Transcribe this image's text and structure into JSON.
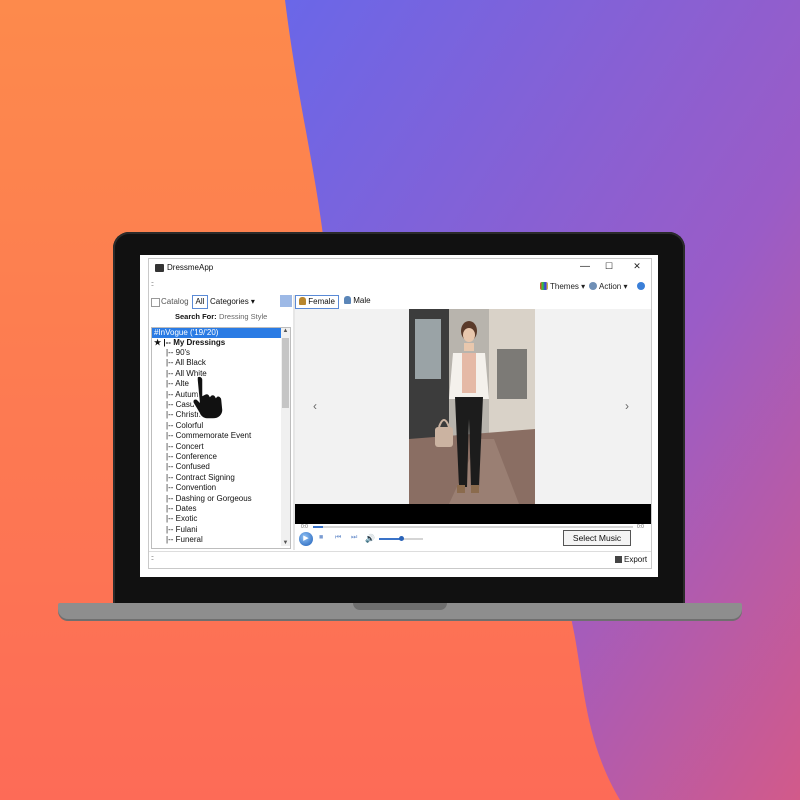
{
  "app": {
    "title": "DressmeApp",
    "window_controls": {
      "minimize": "—",
      "maximize": "☐",
      "close": "✕"
    }
  },
  "toolbar": {
    "grip": "::",
    "themes_label": "Themes",
    "themes_icon": "palette-icon",
    "action_label": "Action",
    "action_icon": "gear-icon",
    "help_icon": "help-icon",
    "dropdown_glyph": "▾"
  },
  "filter": {
    "catalog_label": "Catalog",
    "all_label": "All",
    "categories_label": "Categories",
    "search_for_label": "Search For:",
    "search_for_value": "Dressing Style"
  },
  "tree": {
    "selected_item": "#InVogue ('19/'20)",
    "root_marker": "★",
    "root_label": "|-- My Dressings",
    "items": [
      "|-- 90's",
      "|-- All Black",
      "|-- All White",
      "|-- Alte",
      "|-- Autum",
      "|-- Casua",
      "|-- Christmas",
      "|-- Colorful",
      "|-- Commemorate Event",
      "|-- Concert",
      "|-- Conference",
      "|-- Confused",
      "|-- Contract Signing",
      "|-- Convention",
      "|-- Dashing or Gorgeous",
      "|-- Dates",
      "|-- Exotic",
      "|-- Fulani",
      "|-- Funeral"
    ],
    "scroll_up": "▲",
    "scroll_down": "▼"
  },
  "gender_tabs": {
    "female_label": "Female",
    "male_label": "Male",
    "active": "Female"
  },
  "viewer": {
    "prev_arrow": "‹",
    "next_arrow": "›"
  },
  "player": {
    "elapsed": "0:0",
    "remaining": "0:0",
    "play_icon": "▶",
    "stop_icon": "■",
    "prev_icon": "⏮",
    "next_icon": "⏭",
    "volume_icon": "🔊",
    "select_music_label": "Select Music",
    "seek_position": 0.03,
    "volume_level": 0.5
  },
  "status": {
    "export_label": "Export"
  },
  "colors": {
    "selection_blue": "#2a7be4",
    "accent_blue": "#5a8ad6",
    "background_left": "#fd7a4e",
    "background_right": "#7b5fe0"
  }
}
